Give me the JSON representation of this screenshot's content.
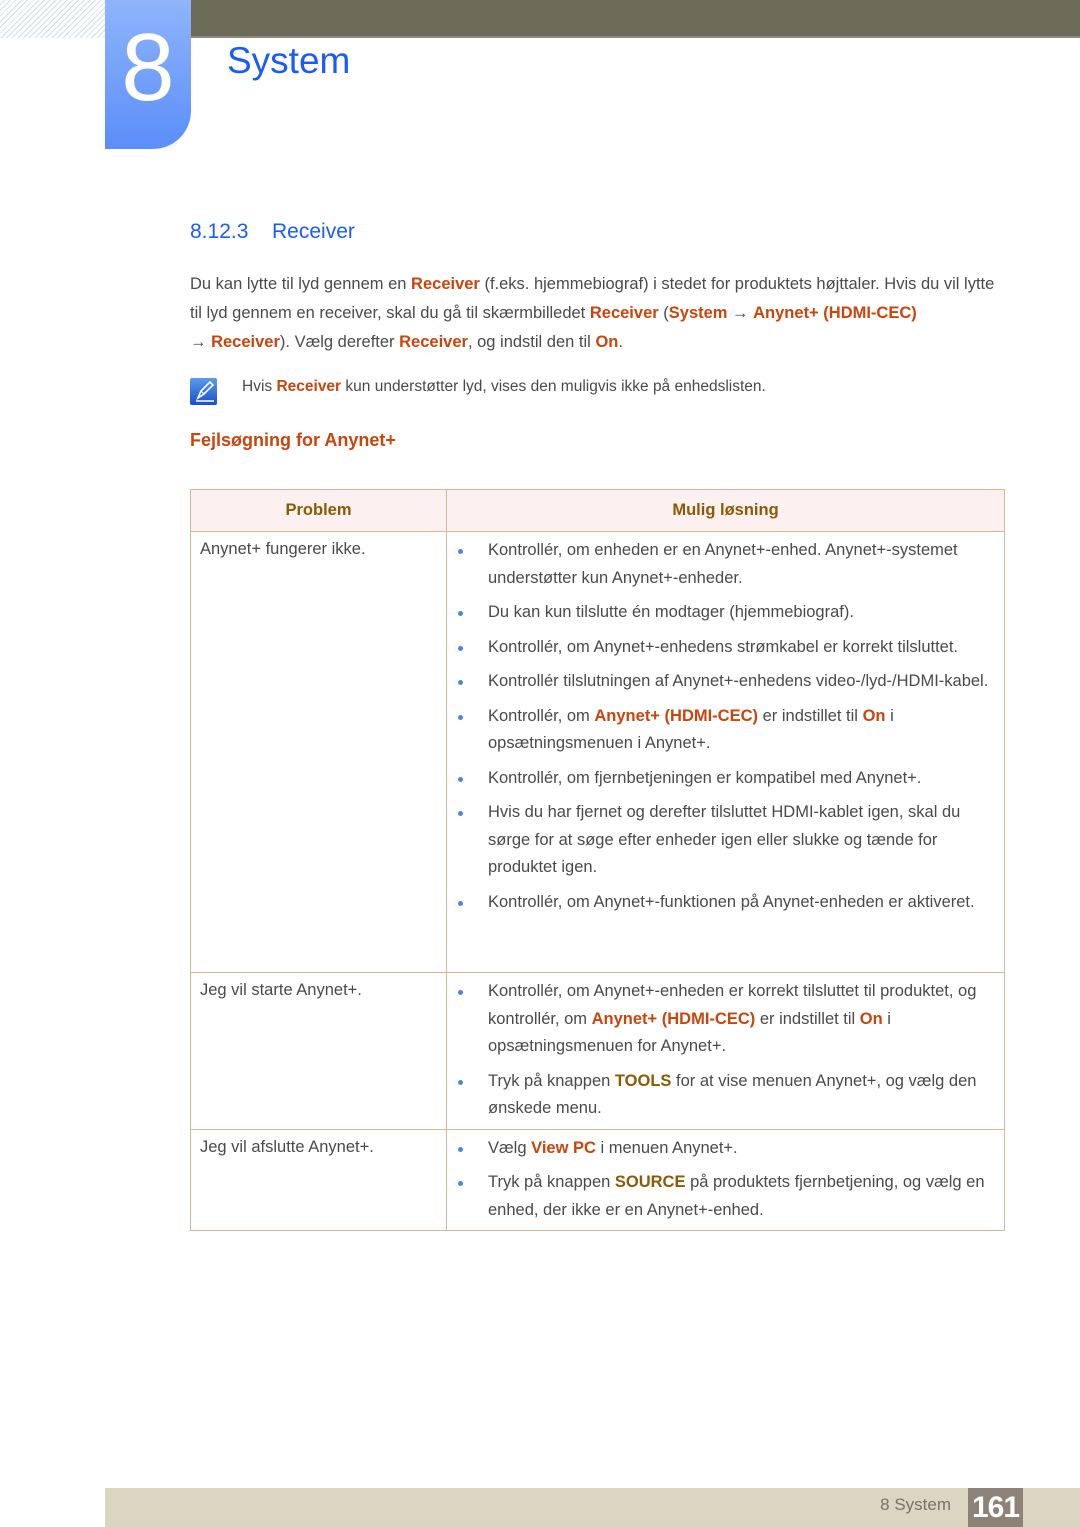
{
  "chapter": {
    "number": "8",
    "title": "System"
  },
  "section": {
    "number": "8.12.3",
    "title": "Receiver"
  },
  "intro": {
    "t1": "Du kan lytte til lyd gennem en ",
    "h1": "Receiver",
    "t2": " (f.eks. hjemmebiograf) i stedet for produktets højttaler. Hvis du vil lytte til lyd gennem en receiver, skal du gå til skærmbilledet ",
    "h2": "Receiver",
    "t3": " (",
    "h3": "System",
    "t4": " → ",
    "h4": "Anynet+ (HDMI-CEC)",
    "t5": " → ",
    "h5": "Receiver",
    "t6": "). Vælg derefter ",
    "h6": "Receiver",
    "t7": ", og indstil den til ",
    "h7": "On",
    "t8": "."
  },
  "note": {
    "icon": "note-pencil-icon",
    "t1": "Hvis ",
    "h1": "Receiver",
    "t2": " kun understøtter lyd, vises den muligvis ikke på enhedslisten."
  },
  "troubleshooting": {
    "heading": "Fejlsøgning for Anynet+",
    "headers": {
      "problem": "Problem",
      "solution": "Mulig løsning"
    },
    "rows": [
      {
        "problem": "Anynet+ fungerer ikke.",
        "solutions": [
          {
            "text": "Kontrollér, om enheden er en Anynet+-enhed. Anynet+-systemet understøtter kun Anynet+-enheder."
          },
          {
            "text": "Du kan kun tilslutte én modtager (hjemmebiograf)."
          },
          {
            "text": "Kontrollér, om Anynet+-enhedens strømkabel er korrekt tilsluttet."
          },
          {
            "text": "Kontrollér tilslutningen af Anynet+-enhedens video-/lyd-/HDMI-kabel."
          },
          {
            "t1": "Kontrollér, om ",
            "h1": "Anynet+ (HDMI-CEC)",
            "t2": " er indstillet til ",
            "h2": "On",
            "t3": " i opsætningsmenuen i Anynet+."
          },
          {
            "text": "Kontrollér, om fjernbetjeningen er kompatibel med Anynet+."
          },
          {
            "text": "Hvis du har fjernet og derefter tilsluttet HDMI-kablet igen, skal du sørge for at søge efter enheder igen eller slukke og tænde for produktet igen."
          },
          {
            "text": "Kontrollér, om Anynet+-funktionen på Anynet-enheden er aktiveret."
          }
        ]
      },
      {
        "problem": "Jeg vil starte Anynet+.",
        "solutions": [
          {
            "t1": "Kontrollér, om Anynet+-enheden er korrekt tilsluttet til produktet, og kontrollér, om ",
            "h1": "Anynet+ (HDMI-CEC)",
            "t2": " er indstillet til ",
            "h2": "On",
            "t3": " i opsætningsmenuen for Anynet+."
          },
          {
            "t1": "Tryk på knappen ",
            "h1": "TOOLS",
            "t2": " for at vise menuen Anynet+, og vælg den ønskede menu."
          }
        ]
      },
      {
        "problem": "Jeg vil afslutte Anynet+.",
        "solutions": [
          {
            "t1": "Vælg ",
            "h1": "View PC",
            "t2": " i menuen Anynet+."
          },
          {
            "t1": "Tryk på knappen ",
            "h1": "SOURCE",
            "t2": " på produktets fjernbetjening, og vælg en enhed, der ikke er en Anynet+-enhed."
          }
        ]
      }
    ]
  },
  "footer": {
    "label": "8 System",
    "page": "161"
  },
  "colors": {
    "heading_blue": "#1a5cf5",
    "highlight_orange": "#c8460e",
    "highlight_olive": "#8a5a05",
    "topbar": "#6c6b58",
    "footer_bg": "#dbd5c1",
    "page_badge": "#8e8278",
    "bullet": "#4a87d8"
  }
}
